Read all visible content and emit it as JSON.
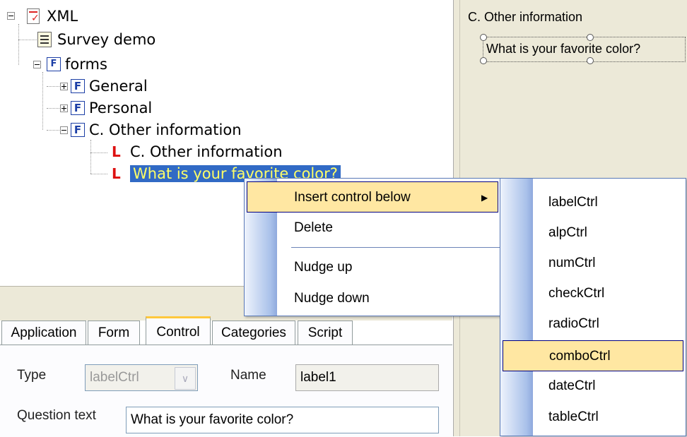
{
  "tree": {
    "root_label": "XML",
    "survey_label": "Survey demo",
    "forms_label": "forms",
    "form_items": [
      "General",
      "Personal",
      "C. Other information"
    ],
    "form_icon_letter": "F",
    "label_items": [
      "C. Other information",
      "What is your favorite color?"
    ]
  },
  "canvas": {
    "heading": "C. Other information",
    "control_text": "What is your favorite color?"
  },
  "context_menu": {
    "items": [
      "Insert control below",
      "Delete",
      "Nudge up",
      "Nudge down"
    ],
    "submenu_arrow": "▶"
  },
  "submenu": {
    "items": [
      "labelCtrl",
      "alpCtrl",
      "numCtrl",
      "checkCtrl",
      "radioCtrl",
      "comboCtrl",
      "dateCtrl",
      "tableCtrl"
    ],
    "highlighted": "comboCtrl"
  },
  "tabs": [
    "Application",
    "Form",
    "Control",
    "Categories",
    "Script"
  ],
  "active_tab": "Control",
  "properties": {
    "type_label": "Type",
    "type_value": "labelCtrl",
    "name_label": "Name",
    "name_value": "label1",
    "question_label": "Question text",
    "question_value": "What is your favorite color?"
  },
  "colors": {
    "selection_bg": "#316ac5",
    "selection_text": "#ffff66",
    "menu_highlight": "#ffe7a2",
    "panel_bg": "#ece9d8",
    "active_tab_accent": "#ffc83c"
  },
  "icons": {
    "root": "xml-document-icon",
    "survey": "survey-list-icon",
    "forms": "forms-folder-icon",
    "form": "form-icon",
    "label": "label-control-icon",
    "expand": "plus-box-icon",
    "collapse": "minus-box-icon"
  }
}
